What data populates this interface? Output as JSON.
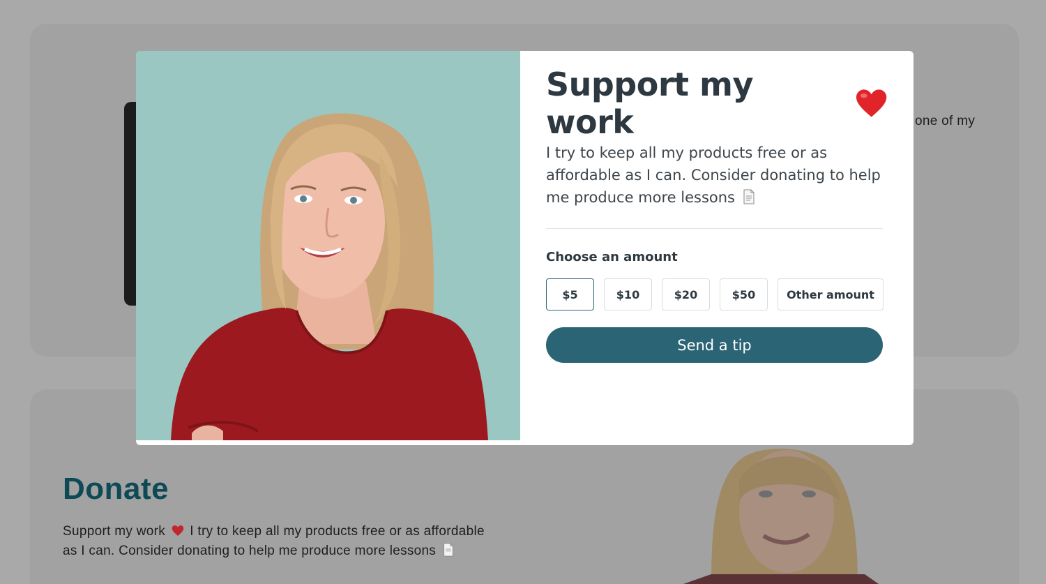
{
  "background": {
    "partial_text": "one of my",
    "donate_title": "Donate",
    "donate_body_prefix": "Support my work",
    "donate_body_suffix": "I try to keep all my products free or as affordable as I can. Consider donating to help me produce more lessons"
  },
  "modal": {
    "title": "Support my work",
    "description": "I try to keep all my products free or as affordable as I can. Consider donating to help me produce more lessons",
    "amount_label": "Choose an amount",
    "amounts": [
      "$5",
      "$10",
      "$20",
      "$50"
    ],
    "other_amount": "Other amount",
    "selected_amount": "$5",
    "send_label": "Send a tip",
    "colors": {
      "accent": "#2b6475",
      "media_bg": "#9ac7c2",
      "heart": "#e0242a"
    }
  }
}
